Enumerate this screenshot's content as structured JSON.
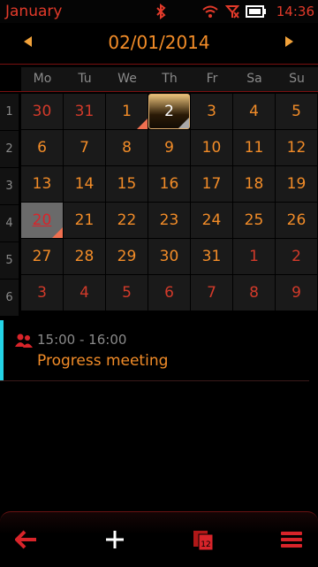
{
  "status": {
    "app_title": "January",
    "time": "14:36"
  },
  "header": {
    "date": "02/01/2014"
  },
  "weekdays": [
    "Mo",
    "Tu",
    "We",
    "Th",
    "Fr",
    "Sa",
    "Su"
  ],
  "weeks": [
    {
      "num": "1",
      "days": [
        {
          "d": "30",
          "other": true
        },
        {
          "d": "31",
          "other": true
        },
        {
          "d": "1",
          "mark": "red"
        },
        {
          "d": "2",
          "today": true,
          "mark": "gray"
        },
        {
          "d": "3"
        },
        {
          "d": "4"
        },
        {
          "d": "5"
        }
      ]
    },
    {
      "num": "2",
      "days": [
        {
          "d": "6"
        },
        {
          "d": "7"
        },
        {
          "d": "8"
        },
        {
          "d": "9"
        },
        {
          "d": "10"
        },
        {
          "d": "11"
        },
        {
          "d": "12"
        }
      ]
    },
    {
      "num": "3",
      "days": [
        {
          "d": "13"
        },
        {
          "d": "14"
        },
        {
          "d": "15"
        },
        {
          "d": "16"
        },
        {
          "d": "17"
        },
        {
          "d": "18"
        },
        {
          "d": "19"
        }
      ]
    },
    {
      "num": "4",
      "days": [
        {
          "d": "20",
          "selected": true,
          "mark": "red"
        },
        {
          "d": "21"
        },
        {
          "d": "22"
        },
        {
          "d": "23"
        },
        {
          "d": "24"
        },
        {
          "d": "25"
        },
        {
          "d": "26"
        }
      ]
    },
    {
      "num": "5",
      "days": [
        {
          "d": "27"
        },
        {
          "d": "28"
        },
        {
          "d": "29"
        },
        {
          "d": "30"
        },
        {
          "d": "31"
        },
        {
          "d": "1",
          "other": true
        },
        {
          "d": "2",
          "other": true
        }
      ]
    },
    {
      "num": "6",
      "days": [
        {
          "d": "3",
          "other": true
        },
        {
          "d": "4",
          "other": true
        },
        {
          "d": "5",
          "other": true
        },
        {
          "d": "6",
          "other": true
        },
        {
          "d": "7",
          "other": true
        },
        {
          "d": "8",
          "other": true
        },
        {
          "d": "9",
          "other": true
        }
      ]
    }
  ],
  "events": [
    {
      "time": "15:00 - 16:00",
      "title": "Progress meeting",
      "icon": "people-icon",
      "color": "#24d4e6"
    }
  ],
  "toolbar": {
    "back_icon": "back-arrow-icon",
    "add_icon": "plus-icon",
    "calendar_icon": "calendar-day-icon",
    "menu_icon": "menu-icon"
  },
  "colors": {
    "accent": "#f28c28",
    "red": "#e23a2a",
    "event_stripe": "#24d4e6"
  }
}
